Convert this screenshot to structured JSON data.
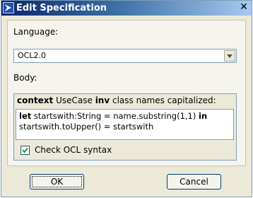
{
  "window": {
    "title": "Edit Specification",
    "app_icon": "arrow-icon",
    "close_label": "✕"
  },
  "language": {
    "label": "Language:",
    "selected": "OCL2.0"
  },
  "body": {
    "label": "Body:",
    "header_kw1": "context",
    "header_text1": " UseCase ",
    "header_kw2": "inv",
    "header_text2": " class names capitalized:",
    "line1_kw": "let",
    "line1_text": " startswith:String = name.substring(1,1) ",
    "line1_kw2": "in",
    "line2_text": "startswith.toUpper() = startswith"
  },
  "check_syntax": {
    "label": "Check OCL syntax",
    "checked": true
  },
  "buttons": {
    "ok": "OK",
    "cancel": "Cancel"
  }
}
